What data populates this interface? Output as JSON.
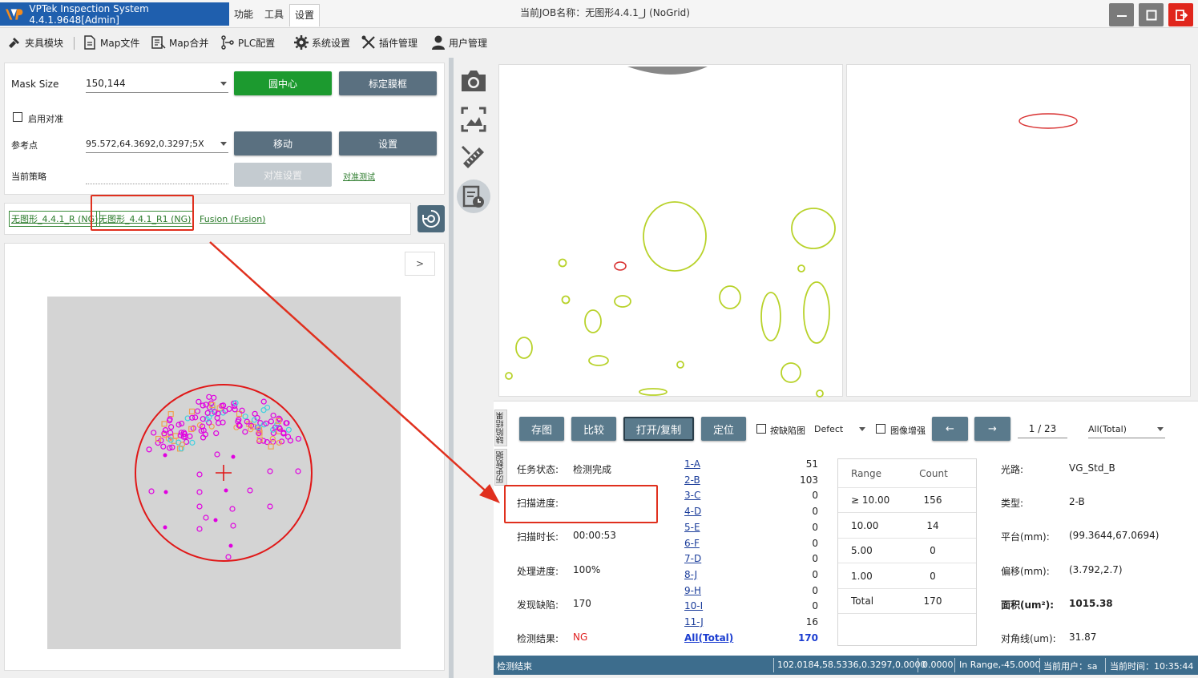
{
  "titlebar": {
    "app_title": "VPTek Inspection System 4.4.1.9648[Admin]",
    "menu": [
      "功能",
      "工具",
      "设置"
    ],
    "job_title": "当前JOB名称：无图形4.4.1_J (NoGrid)"
  },
  "toolbar": {
    "items": [
      "夹具模块",
      "Map文件",
      "Map合并",
      "PLC配置",
      "系统设置",
      "插件管理",
      "用户管理"
    ]
  },
  "settings": {
    "mask_size_label": "Mask Size",
    "mask_size_value": "150,144",
    "circle_center_btn": "圆中心",
    "calib_frame_btn": "标定膜框",
    "enable_align_label": "启用对准",
    "ref_point_label": "参考点",
    "ref_point_value": "95.572,64.3692,0.3297;5X",
    "move_btn": "移动",
    "setup_btn": "设置",
    "strategy_label": "当前策略",
    "align_setup_btn": "对准设置",
    "align_test_link": "对准测试"
  },
  "recipe_tabs": [
    "无图形_4.4.1_R (NG)",
    "无图形_4.4.1_R1 (NG)",
    "Fusion (Fusion)"
  ],
  "map_panel": {
    "expand_label": ">"
  },
  "results": {
    "side_tabs": [
      "缺陷结果",
      "历史数据"
    ],
    "buttons": {
      "save_img": "存图",
      "compare": "比较",
      "open_copy": "打开/复制",
      "locate": "定位",
      "by_defect_label": "按缺陷图",
      "defect_combo": "Defect",
      "img_enhance_label": "图像增强",
      "prev": "←",
      "next": "→",
      "page_current": "1",
      "page_sep": "/",
      "page_total": "23",
      "filter_combo": "All(Total)"
    },
    "task": {
      "status_label": "任务状态:",
      "status_value": "检测完成",
      "scan_progress_label": "扫描进度:",
      "scan_time_label": "扫描时长:",
      "scan_time_value": "00:00:53",
      "proc_progress_label": "处理进度:",
      "proc_progress_value": "100%",
      "found_label": "发现缺陷:",
      "found_value": "170",
      "result_label": "检测结果:",
      "result_value": "NG",
      "result_color": "#e02020"
    },
    "categories": [
      {
        "name": "1-A",
        "count": "51"
      },
      {
        "name": "2-B",
        "count": "103"
      },
      {
        "name": "3-C",
        "count": "0"
      },
      {
        "name": "4-D",
        "count": "0"
      },
      {
        "name": "5-E",
        "count": "0"
      },
      {
        "name": "6-F",
        "count": "0"
      },
      {
        "name": "7-D",
        "count": "0"
      },
      {
        "name": "8-J",
        "count": "0"
      },
      {
        "name": "9-H",
        "count": "0"
      },
      {
        "name": "10-I",
        "count": "0"
      },
      {
        "name": "11-J",
        "count": "16"
      },
      {
        "name": "All(Total)",
        "count": "170"
      }
    ],
    "range_table": {
      "header": [
        "Range",
        "Count"
      ],
      "rows": [
        {
          "range": "≥ 10.00",
          "count": "156"
        },
        {
          "range": "10.00",
          "count": "14"
        },
        {
          "range": "5.00",
          "count": "0"
        },
        {
          "range": "1.00",
          "count": "0"
        },
        {
          "range": "Total",
          "count": "170"
        }
      ]
    },
    "info": {
      "optics_label": "光路:",
      "optics_value": "VG_Std_B",
      "type_label": "类型:",
      "type_value": "2-B",
      "platform_label": "平台(mm):",
      "platform_value": "(99.3644,67.0694)",
      "offset_label": "偏移(mm):",
      "offset_value": "(3.792,2.7)",
      "area_label": "面积(um²):",
      "area_value": "1015.38",
      "diag_label": "对角线(um):",
      "diag_value": "31.87"
    }
  },
  "statusbar": {
    "left": "检测结束",
    "coords": "102.0184,58.5336,0.3297,0.0000",
    "val": "0.0000",
    "range": "In Range,-45.0000",
    "user": "当前用户：sa",
    "time": "当前时间：10:35:44"
  },
  "colors": {
    "accent": "#1f5fae",
    "button_grey": "#5a7080",
    "button_green": "#1c9a2f",
    "statusbar": "#3d6d8d",
    "annotation": "#e0301e"
  }
}
